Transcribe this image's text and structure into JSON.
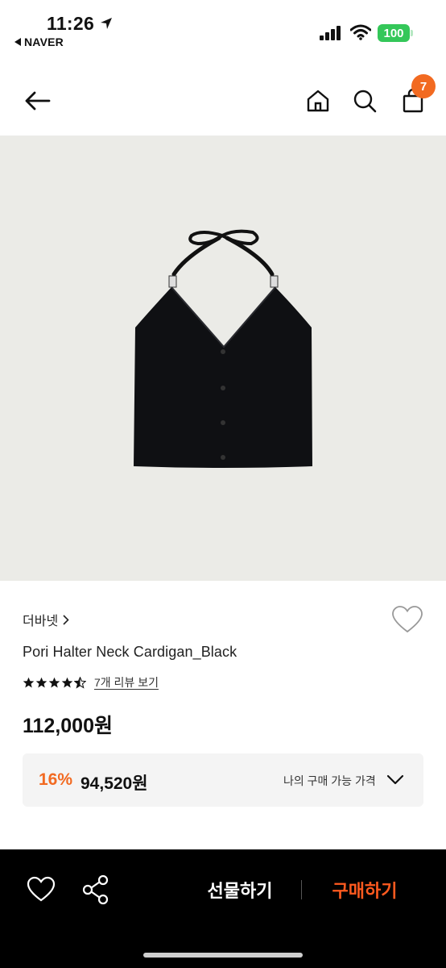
{
  "status": {
    "time": "11:26",
    "back_app": "NAVER",
    "battery": "100"
  },
  "header": {
    "cart_count": "7"
  },
  "product": {
    "brand": "더바넷",
    "name": "Pori Halter Neck Cardigan_Black",
    "rating": 4.5,
    "review_link": "7개 리뷰 보기",
    "price": "112,000원",
    "discount_rate": "16%",
    "discount_price": "94,520원",
    "my_price_label": "나의 구매 가능 가격"
  },
  "bottom": {
    "gift_label": "선물하기",
    "buy_label": "구매하기"
  },
  "colors": {
    "accent": "#f26a21",
    "buy": "#ff5a1f",
    "battery": "#34c759"
  }
}
